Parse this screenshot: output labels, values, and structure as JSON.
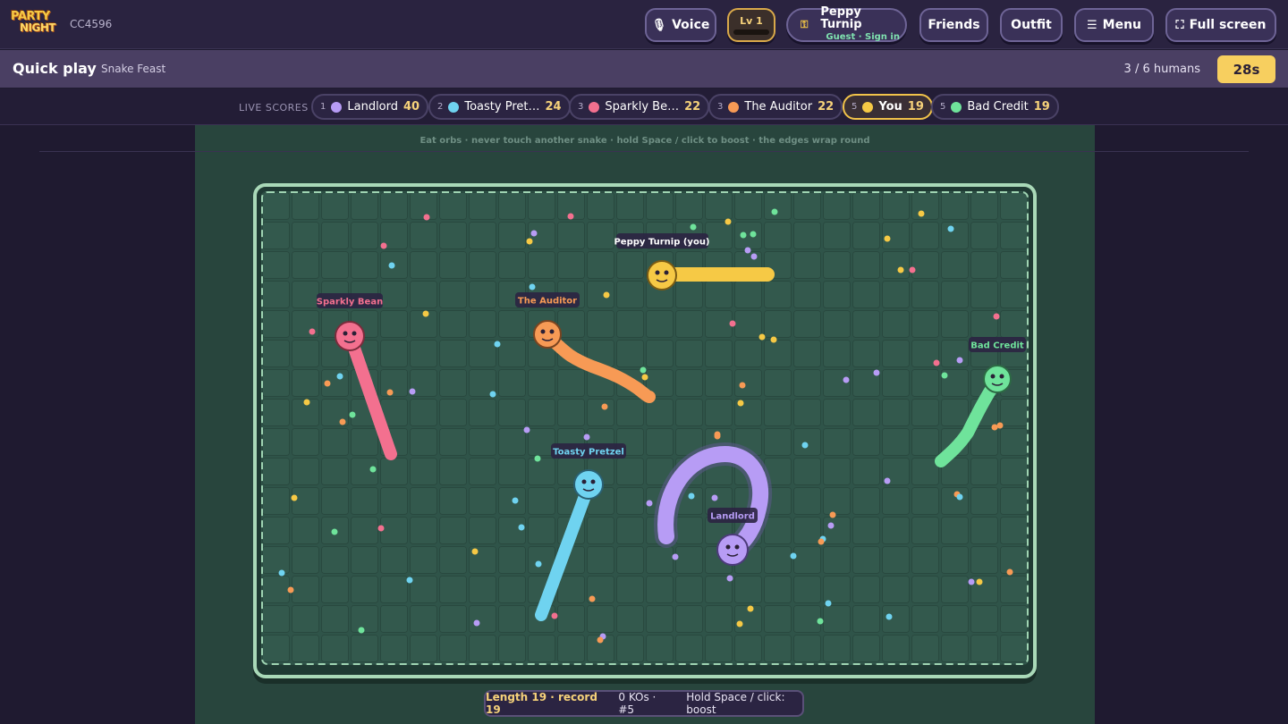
{
  "topbar": {
    "logo_line1": "PARTY",
    "logo_line2": "NIGHT",
    "room_code": "CC4596",
    "voice_label": "Voice",
    "level_label": "Lv 1",
    "profile_name": "Peppy Turnip",
    "profile_status": "Guest · Sign in",
    "friends_label": "Friends",
    "outfit_label": "Outfit",
    "menu_label": "Menu",
    "fullscreen_label": "Full screen",
    "icons": [
      "mic-icon",
      "key-icon",
      "menu-icon",
      "fullscreen-icon"
    ]
  },
  "subbar": {
    "title": "Quick play",
    "mode": "Snake Feast",
    "humans": "3 / 6 humans",
    "timer": "28s"
  },
  "scores": {
    "label": "LIVE SCORES",
    "players": [
      {
        "rank": "1",
        "name": "Landlord",
        "score": "40",
        "color": "#b79cf5"
      },
      {
        "rank": "2",
        "name": "Toasty Pret…",
        "score": "24",
        "color": "#6fd3f0"
      },
      {
        "rank": "3",
        "name": "Sparkly Be…",
        "score": "22",
        "color": "#f3708f"
      },
      {
        "rank": "3",
        "name": "The Auditor",
        "score": "22",
        "color": "#f79a55"
      },
      {
        "rank": "5",
        "name": "You",
        "score": "19",
        "color": "#f6c945"
      },
      {
        "rank": "5",
        "name": "Bad Credit",
        "score": "19",
        "color": "#6fe39b"
      }
    ]
  },
  "game": {
    "hint": "Eat orbs · never touch another snake · hold Space / click to boost · the edges wrap round",
    "snakes": [
      {
        "name": "Peppy Turnip (you)",
        "color": "#f6c945"
      },
      {
        "name": "Sparkly Bean",
        "color": "#f3708f"
      },
      {
        "name": "The Auditor",
        "color": "#f79a55"
      },
      {
        "name": "Toasty Pretzel",
        "color": "#6fd3f0"
      },
      {
        "name": "Landlord",
        "color": "#b79cf5"
      },
      {
        "name": "Bad Credit",
        "color": "#6fe39b"
      }
    ]
  },
  "status": {
    "length": "Length 19 · record 19",
    "kos": "0 KOs · #5",
    "boost": "Hold Space / click: boost"
  }
}
